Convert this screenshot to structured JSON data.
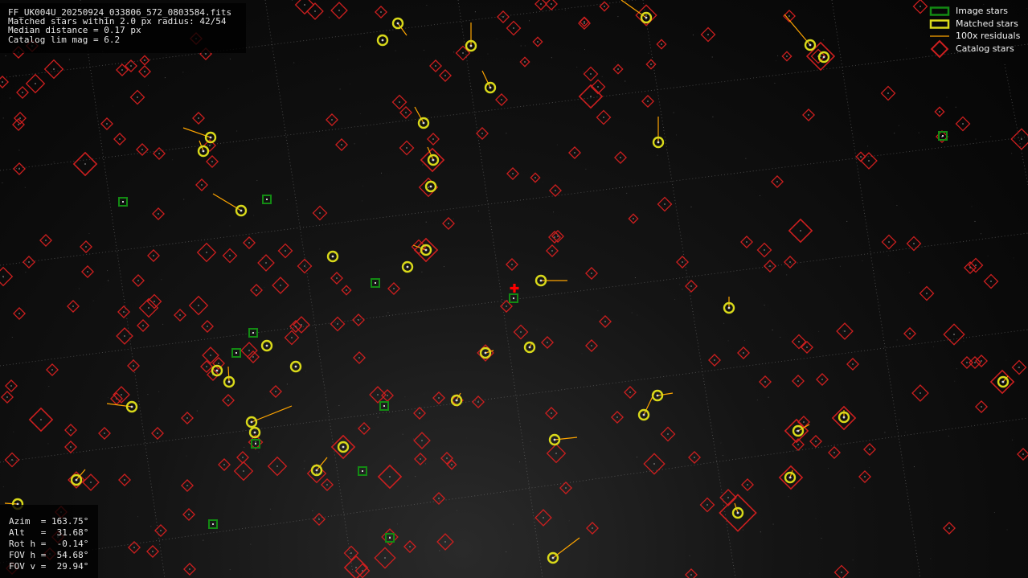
{
  "viewer": {
    "file_name": "FF_UK004U_20250924_033806_572_0803584.fits",
    "matched_line": "Matched stars within 2.0 px radius: 42/54",
    "median_line": "Median distance = 0.17 px",
    "limmag_line": "Catalog lim mag = 6.2"
  },
  "legend": {
    "items": [
      {
        "label": "Image stars",
        "symbol": "image-star"
      },
      {
        "label": "Matched stars",
        "symbol": "matched-star"
      },
      {
        "label": "100x residuals",
        "symbol": "residual"
      },
      {
        "label": "Catalog stars",
        "symbol": "catalog-star"
      }
    ]
  },
  "pointing": {
    "azim": "Azim  = 163.75°",
    "alt": "Alt   =  31.68°",
    "roth": "Rot h =  -0.14°",
    "fovh": "FOV h =  54.68°",
    "fovv": "FOV v =  29.94°"
  },
  "colors": {
    "catalog": "#cc1f1f",
    "matched": "#d9d91a",
    "residual": "#ffa500",
    "image": "#138a13",
    "center_marker": "#ff0000",
    "grid": "#8a8a8a",
    "text": "#e6e6e6"
  }
}
